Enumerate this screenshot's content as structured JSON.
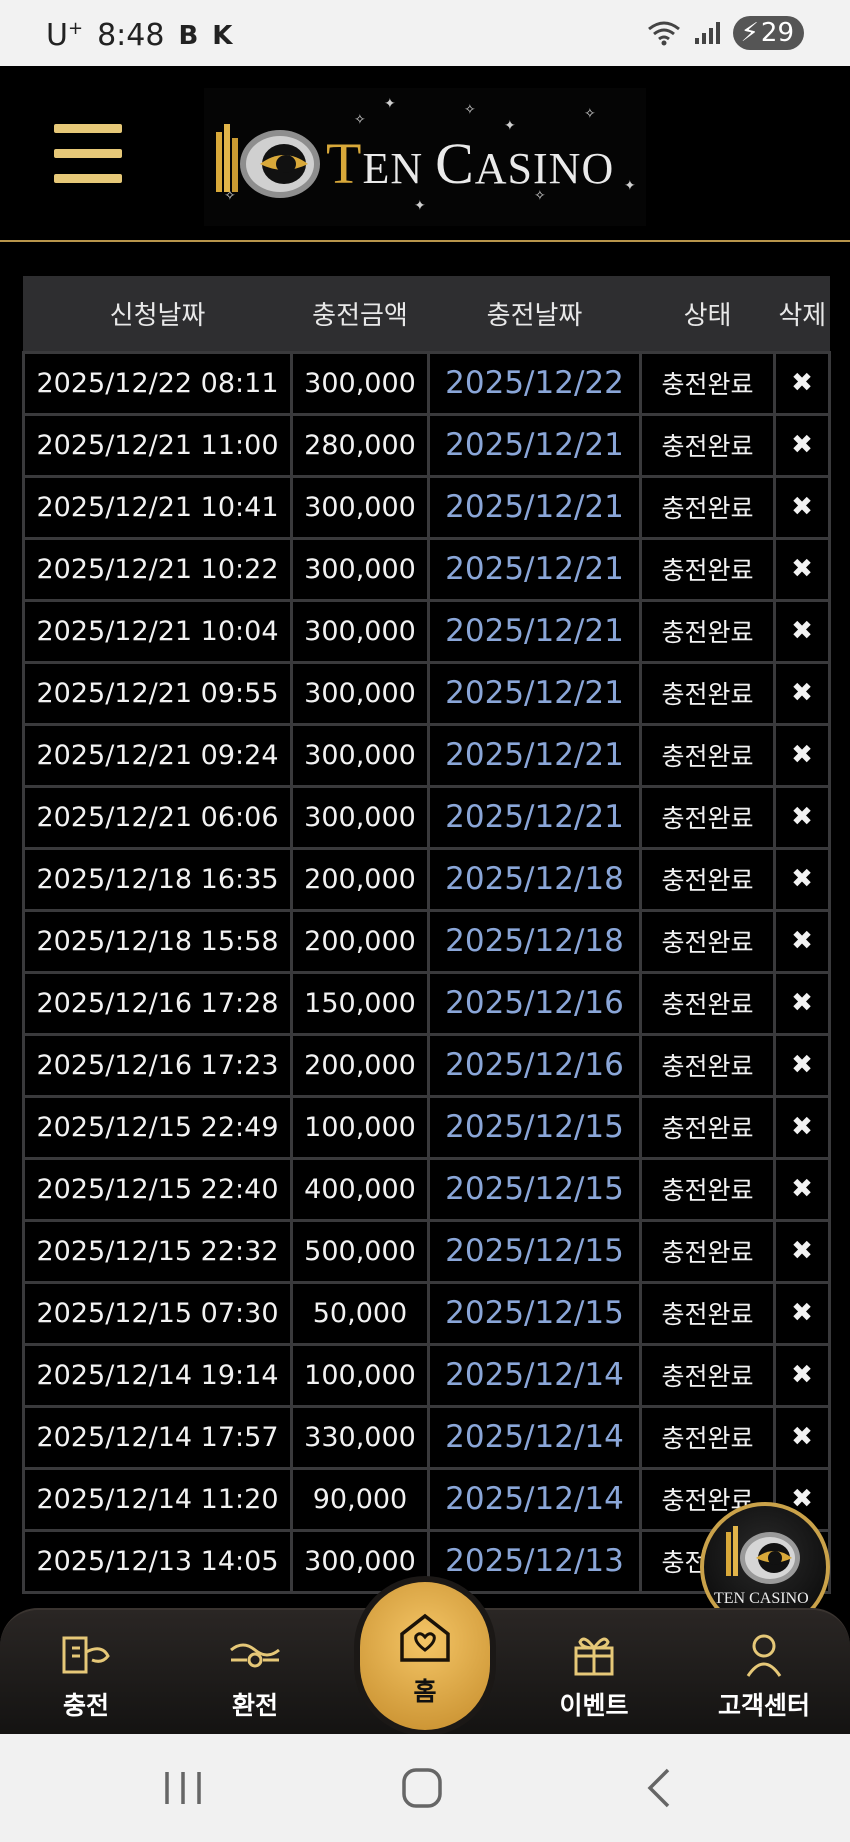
{
  "status_bar": {
    "carrier": "U",
    "carrier_sup": "+",
    "time": "8:48",
    "battery": "29"
  },
  "header": {
    "logo_text_first": "T",
    "logo_text_rest1": "EN ",
    "logo_text_c": "C",
    "logo_text_rest2": "ASINO"
  },
  "table": {
    "columns": [
      "신청날짜",
      "충전금액",
      "충전날짜",
      "상태",
      "삭제"
    ],
    "rows": [
      {
        "requested": "2025/12/22 08:11",
        "amount": "300,000",
        "charged": "2025/12/22",
        "status": "충전완료",
        "delete": "✖"
      },
      {
        "requested": "2025/12/21 11:00",
        "amount": "280,000",
        "charged": "2025/12/21",
        "status": "충전완료",
        "delete": "✖"
      },
      {
        "requested": "2025/12/21 10:41",
        "amount": "300,000",
        "charged": "2025/12/21",
        "status": "충전완료",
        "delete": "✖"
      },
      {
        "requested": "2025/12/21 10:22",
        "amount": "300,000",
        "charged": "2025/12/21",
        "status": "충전완료",
        "delete": "✖"
      },
      {
        "requested": "2025/12/21 10:04",
        "amount": "300,000",
        "charged": "2025/12/21",
        "status": "충전완료",
        "delete": "✖"
      },
      {
        "requested": "2025/12/21 09:55",
        "amount": "300,000",
        "charged": "2025/12/21",
        "status": "충전완료",
        "delete": "✖"
      },
      {
        "requested": "2025/12/21 09:24",
        "amount": "300,000",
        "charged": "2025/12/21",
        "status": "충전완료",
        "delete": "✖"
      },
      {
        "requested": "2025/12/21 06:06",
        "amount": "300,000",
        "charged": "2025/12/21",
        "status": "충전완료",
        "delete": "✖"
      },
      {
        "requested": "2025/12/18 16:35",
        "amount": "200,000",
        "charged": "2025/12/18",
        "status": "충전완료",
        "delete": "✖"
      },
      {
        "requested": "2025/12/18 15:58",
        "amount": "200,000",
        "charged": "2025/12/18",
        "status": "충전완료",
        "delete": "✖"
      },
      {
        "requested": "2025/12/16 17:28",
        "amount": "150,000",
        "charged": "2025/12/16",
        "status": "충전완료",
        "delete": "✖"
      },
      {
        "requested": "2025/12/16 17:23",
        "amount": "200,000",
        "charged": "2025/12/16",
        "status": "충전완료",
        "delete": "✖"
      },
      {
        "requested": "2025/12/15 22:49",
        "amount": "100,000",
        "charged": "2025/12/15",
        "status": "충전완료",
        "delete": "✖"
      },
      {
        "requested": "2025/12/15 22:40",
        "amount": "400,000",
        "charged": "2025/12/15",
        "status": "충전완료",
        "delete": "✖"
      },
      {
        "requested": "2025/12/15 22:32",
        "amount": "500,000",
        "charged": "2025/12/15",
        "status": "충전완료",
        "delete": "✖"
      },
      {
        "requested": "2025/12/15 07:30",
        "amount": "50,000",
        "charged": "2025/12/15",
        "status": "충전완료",
        "delete": "✖"
      },
      {
        "requested": "2025/12/14 19:14",
        "amount": "100,000",
        "charged": "2025/12/14",
        "status": "충전완료",
        "delete": "✖"
      },
      {
        "requested": "2025/12/14 17:57",
        "amount": "330,000",
        "charged": "2025/12/14",
        "status": "충전완료",
        "delete": "✖"
      },
      {
        "requested": "2025/12/14 11:20",
        "amount": "90,000",
        "charged": "2025/12/14",
        "status": "충전완료",
        "delete": "✖"
      },
      {
        "requested": "2025/12/13 14:05",
        "amount": "300,000",
        "charged": "2025/12/13",
        "status": "충전완료",
        "delete": "✖"
      }
    ]
  },
  "bottom_nav": {
    "charge": "충전",
    "exchange": "환전",
    "home": "홈",
    "event": "이벤트",
    "support": "고객센터"
  },
  "floating_logo_text": "TEN CASINO",
  "colors": {
    "gold": "#d9a93a",
    "charged_date": "#8aa6d8",
    "header_row": "#2e2e30",
    "cell_border": "#3a3a3c"
  }
}
